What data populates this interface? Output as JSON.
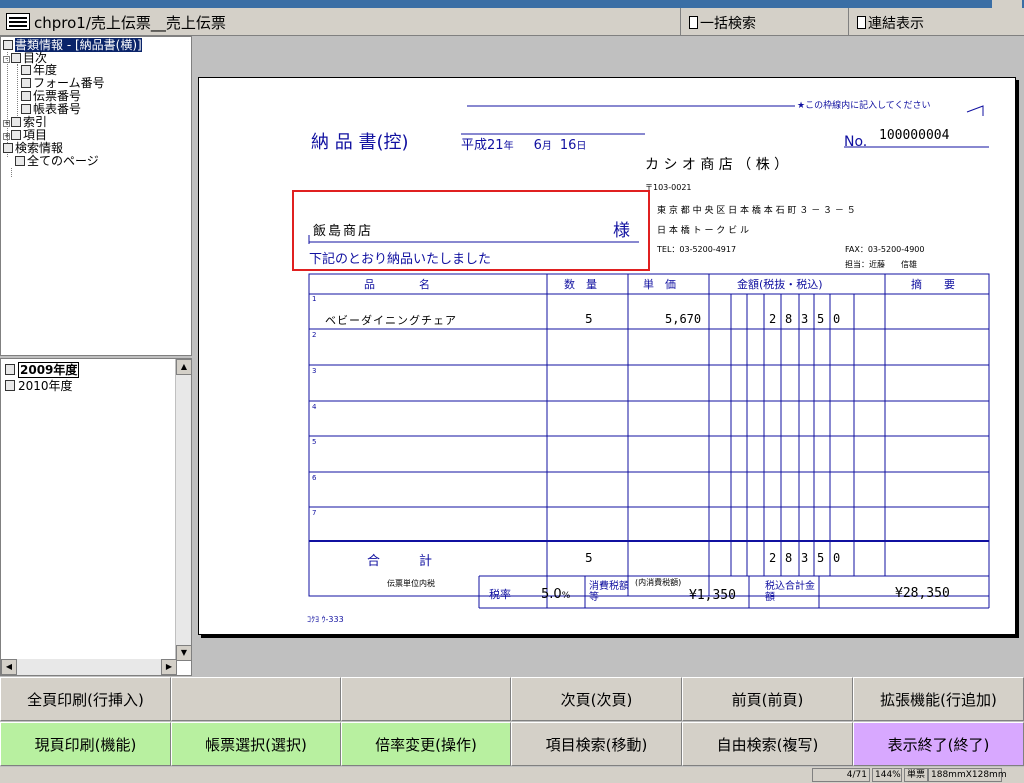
{
  "toolbar": {
    "title": "chpro1/売上伝票__売上伝票",
    "bulk_search": "一括検索",
    "linked_view": "連結表示"
  },
  "tree": {
    "root": "書類情報 - [納品書(横)]",
    "toc": "目次",
    "toc_items": [
      "年度",
      "フォーム番号",
      "伝票番号",
      "帳表番号"
    ],
    "index": "索引",
    "item": "項目",
    "search_info": "検索情報",
    "all_pages": "全てのページ"
  },
  "years": [
    "2009年度",
    "2010年度"
  ],
  "document": {
    "note": "★この枠線内に記入してください",
    "title": "納 品 書(控)",
    "date_era": "平成",
    "date_year": "21",
    "date_year_unit": "年",
    "date_month": "6",
    "date_month_unit": "月",
    "date_day": "16",
    "date_day_unit": "日",
    "no_label": "No.",
    "no_value": "100000004",
    "company": "カ シ オ 商 店 （ 株 ）",
    "postal": "〒103-0021",
    "address1": "東 京 都 中 央 区 日 本 橋 本 石 町 ３ － ３ － ５",
    "address2": "日 本 橋 ト ー ク ビ ル",
    "tel": "TEL：03-5200-4917",
    "fax": "FAX：03-5200-4900",
    "person": "担当：近藤　　信雄",
    "customer": "飯島商店",
    "honorific": "様",
    "delivered_msg": "下記のとおり納品いたしました",
    "headers": {
      "item": "品　　　　名",
      "qty": "数　量",
      "price": "単　価",
      "amount": "金額(税抜・税込)",
      "remarks": "摘　　要"
    },
    "row_numbers": [
      "1",
      "2",
      "3",
      "4",
      "5",
      "6",
      "7"
    ],
    "row1_item": "ベビーダイニングチェア",
    "row1_qty": "5",
    "row1_price": "5,670",
    "row1_amount_digits": [
      "2",
      "8",
      "3",
      "5",
      "0"
    ],
    "total_label": "合　　　計",
    "total_qty": "5",
    "total_digits": [
      "2",
      "8",
      "3",
      "5",
      "0"
    ],
    "tax_note": "伝票単位内税",
    "tax_rate_label": "税率",
    "tax_rate": "5.0",
    "percent": "%",
    "tax_amount_label": "消費税額等",
    "inner_tax_label": "(内消費税額)",
    "inner_tax": "¥1,350",
    "total_incl_label": "税込合計金額",
    "total_incl": "¥28,350",
    "code": "ｺｸﾖ ｳ-333"
  },
  "buttons": {
    "row1": [
      "全頁印刷(行挿入)",
      "",
      "",
      "次頁(次頁)",
      "前頁(前頁)",
      "拡張機能(行追加)"
    ],
    "row2": [
      "現頁印刷(機能)",
      "帳票選択(選択)",
      "倍率変更(操作)",
      "項目検索(移動)",
      "自由検索(複写)",
      "表示終了(終了)"
    ]
  },
  "status": {
    "page": "4/71",
    "zoom": "144%",
    "mode": "単票",
    "size": "188mmX128mm"
  },
  "colors": {
    "doc_blue": "#1010a0",
    "highlight_red": "#e02020",
    "btn_green": "#b8f0a0",
    "btn_purple": "#d8a8ff"
  }
}
